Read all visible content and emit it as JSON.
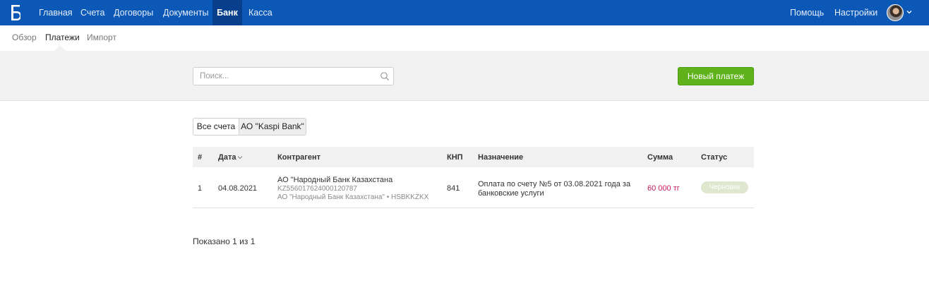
{
  "topbar": {
    "logo_glyph": "Б",
    "nav": [
      "Главная",
      "Счета",
      "Договоры",
      "Документы",
      "Банк",
      "Касса"
    ],
    "active_nav": "Банк",
    "help": "Помощь",
    "settings": "Настройки",
    "bar_color": "#0b58b7"
  },
  "subnav": {
    "items": [
      "Обзор",
      "Платежи",
      "Импорт"
    ],
    "active": "Платежи"
  },
  "toolbar": {
    "search_placeholder": "Поиск...",
    "new_payment": "Новый платеж",
    "button_color": "#5fb21a"
  },
  "accounts_filter": {
    "all": "Все счета",
    "kaspi": "АО \"Kaspi Bank\"",
    "selected": "АО \"Kaspi Bank\""
  },
  "table": {
    "headers": {
      "num": "#",
      "date": "Дата",
      "counterparty": "Контрагент",
      "knp": "КНП",
      "purpose": "Назначение",
      "amount": "Сумма",
      "status": "Статус"
    },
    "sorted_by": "Дата",
    "rows": [
      {
        "num": "1",
        "date": "04.08.2021",
        "counterparty_name": "АО \"Народный Банк Казахстана",
        "account": "KZ556017624000120787",
        "bank": "АО \"Народный Банк Казахстана\" • HSBKKZKX",
        "knp": "841",
        "purpose_line1": "Оплата по счету №5 от 03.08.2021 года за",
        "purpose_line2": "банковские услуги",
        "amount": "60 000 тг",
        "status": "Черновик"
      }
    ]
  },
  "footer": {
    "shown": "Показано 1 из 1"
  }
}
